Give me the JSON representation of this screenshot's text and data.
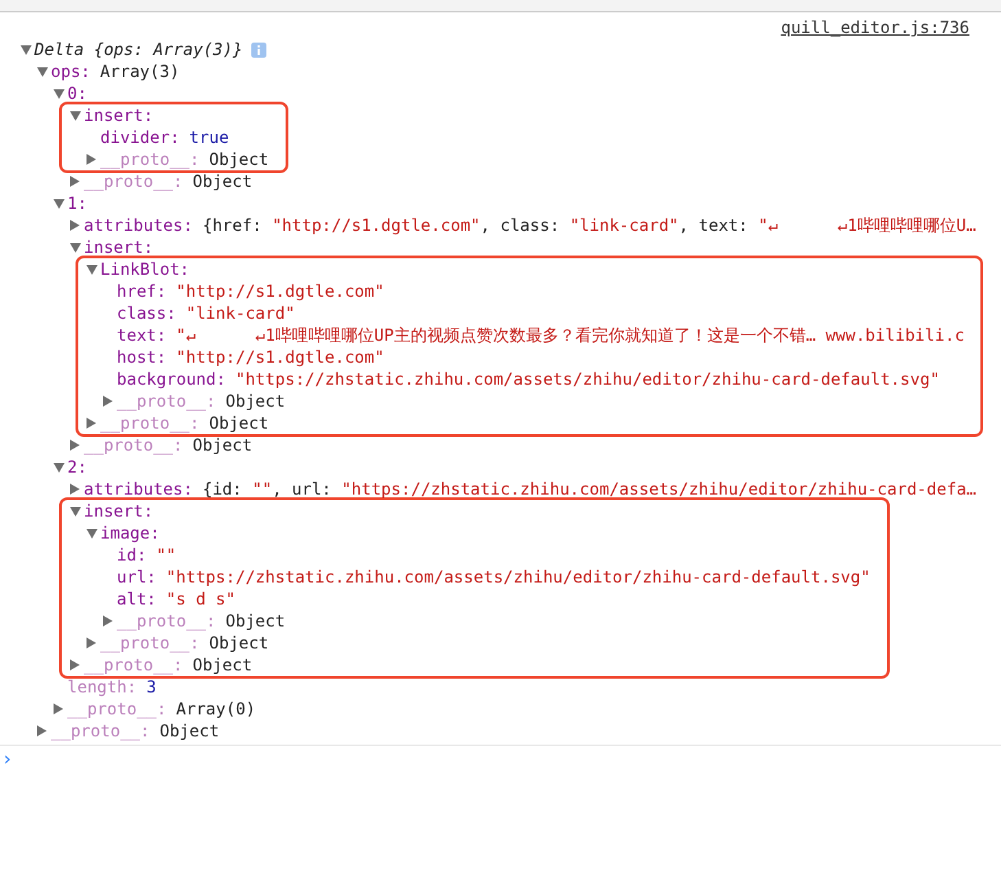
{
  "source_link": "quill_editor.js:736",
  "tree": {
    "kind": "root",
    "label": "Delta {ops: Array(3)}",
    "expanded": true,
    "children": [
      {
        "kind": "property",
        "key": "ops:",
        "value": {
          "kind": "plain",
          "text": "Array(3)"
        },
        "expanded": true,
        "children": [
          {
            "kind": "property",
            "key": "0:",
            "expanded": true,
            "children": [
              {
                "kind": "group",
                "children": [
                  {
                    "kind": "property",
                    "key": "insert:",
                    "expanded": true,
                    "children": [
                      {
                        "kind": "property",
                        "key": "divider:",
                        "value": {
                          "kind": "keyword",
                          "text": "true"
                        }
                      },
                      {
                        "kind": "internal",
                        "key": "__proto__:",
                        "value": {
                          "kind": "plain",
                          "text": "Object"
                        },
                        "expanded": false
                      }
                    ]
                  }
                ]
              },
              {
                "kind": "internal",
                "key": "__proto__:",
                "value": {
                  "kind": "plain",
                  "text": "Object"
                },
                "expanded": false
              }
            ]
          },
          {
            "kind": "property",
            "key": "1:",
            "expanded": true,
            "children": [
              {
                "kind": "property",
                "key": "attributes:",
                "expanded": false,
                "preview": [
                  {
                    "kind": "plain",
                    "text": "{href: "
                  },
                  {
                    "kind": "string",
                    "text": "\"http://s1.dgtle.com\""
                  },
                  {
                    "kind": "plain",
                    "text": ", class: "
                  },
                  {
                    "kind": "string",
                    "text": "\"link-card\""
                  },
                  {
                    "kind": "plain",
                    "text": ", text: "
                  },
                  {
                    "kind": "string",
                    "text": "\"↵      ↵1哔哩哔哩哪位U…"
                  }
                ]
              },
              {
                "kind": "property",
                "key": "insert:",
                "expanded": true,
                "children": [
                  {
                    "kind": "group",
                    "children": [
                      {
                        "kind": "property",
                        "key": "LinkBlot:",
                        "expanded": true,
                        "children": [
                          {
                            "kind": "property",
                            "key": "href:",
                            "value": {
                              "kind": "string",
                              "text": "\"http://s1.dgtle.com\""
                            }
                          },
                          {
                            "kind": "property",
                            "key": "class:",
                            "value": {
                              "kind": "string",
                              "text": "\"link-card\""
                            }
                          },
                          {
                            "kind": "property",
                            "key": "text:",
                            "value": {
                              "kind": "string",
                              "text": "\"↵      ↵1哔哩哔哩哪位UP主的视频点赞次数最多？看完你就知道了！这是一个不错… www.bilibili.c"
                            }
                          },
                          {
                            "kind": "property",
                            "key": "host:",
                            "value": {
                              "kind": "string",
                              "text": "\"http://s1.dgtle.com\""
                            }
                          },
                          {
                            "kind": "property",
                            "key": "background:",
                            "value": {
                              "kind": "string",
                              "text": "\"https://zhstatic.zhihu.com/assets/zhihu/editor/zhihu-card-default.svg\""
                            }
                          },
                          {
                            "kind": "internal",
                            "key": "__proto__:",
                            "value": {
                              "kind": "plain",
                              "text": "Object"
                            },
                            "expanded": false
                          }
                        ]
                      },
                      {
                        "kind": "internal",
                        "key": "__proto__:",
                        "value": {
                          "kind": "plain",
                          "text": "Object"
                        },
                        "expanded": false
                      }
                    ]
                  }
                ]
              },
              {
                "kind": "internal",
                "key": "__proto__:",
                "value": {
                  "kind": "plain",
                  "text": "Object"
                },
                "expanded": false
              }
            ]
          },
          {
            "kind": "property",
            "key": "2:",
            "expanded": true,
            "children": [
              {
                "kind": "property",
                "key": "attributes:",
                "expanded": false,
                "preview": [
                  {
                    "kind": "plain",
                    "text": "{id: "
                  },
                  {
                    "kind": "string",
                    "text": "\"\""
                  },
                  {
                    "kind": "plain",
                    "text": ", url: "
                  },
                  {
                    "kind": "string",
                    "text": "\"https://zhstatic.zhihu.com/assets/zhihu/editor/zhihu-card-defa…"
                  }
                ]
              },
              {
                "kind": "group",
                "children": [
                  {
                    "kind": "property",
                    "key": "insert:",
                    "expanded": true,
                    "children": [
                      {
                        "kind": "property",
                        "key": "image:",
                        "expanded": true,
                        "children": [
                          {
                            "kind": "property",
                            "key": "id:",
                            "value": {
                              "kind": "string",
                              "text": "\"\""
                            }
                          },
                          {
                            "kind": "property",
                            "key": "url:",
                            "value": {
                              "kind": "string",
                              "text": "\"https://zhstatic.zhihu.com/assets/zhihu/editor/zhihu-card-default.svg\""
                            }
                          },
                          {
                            "kind": "property",
                            "key": "alt:",
                            "value": {
                              "kind": "string",
                              "text": "\"s d s\""
                            }
                          },
                          {
                            "kind": "internal",
                            "key": "__proto__:",
                            "value": {
                              "kind": "plain",
                              "text": "Object"
                            },
                            "expanded": false
                          }
                        ]
                      },
                      {
                        "kind": "internal",
                        "key": "__proto__:",
                        "value": {
                          "kind": "plain",
                          "text": "Object"
                        },
                        "expanded": false
                      }
                    ]
                  },
                  {
                    "kind": "internal",
                    "key": "__proto__:",
                    "value": {
                      "kind": "plain",
                      "text": "Object"
                    },
                    "expanded": false
                  }
                ]
              }
            ]
          },
          {
            "kind": "internal",
            "key": "length:",
            "value": {
              "kind": "number",
              "text": "3"
            }
          },
          {
            "kind": "internal",
            "key": "__proto__:",
            "value": {
              "kind": "plain",
              "text": "Array(0)"
            },
            "expanded": false
          }
        ]
      },
      {
        "kind": "internal",
        "key": "__proto__:",
        "value": {
          "kind": "plain",
          "text": "Object"
        },
        "expanded": false
      }
    ]
  },
  "prompt": "›"
}
